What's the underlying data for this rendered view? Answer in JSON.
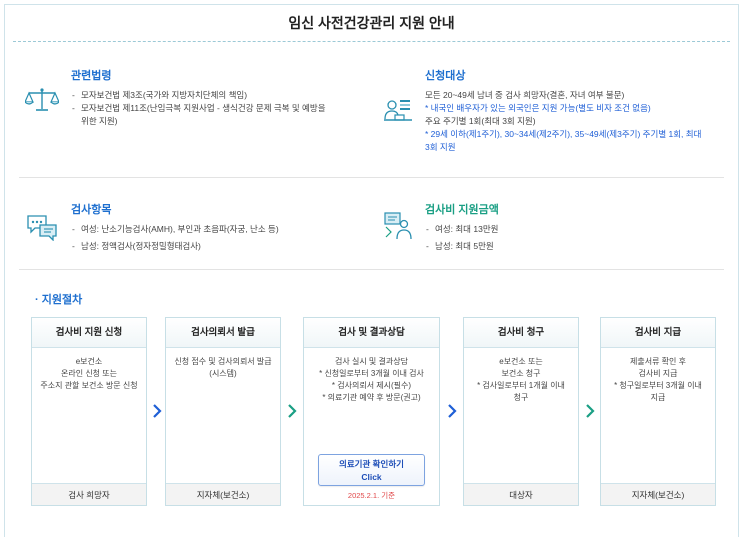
{
  "page_title": "임신 사전건강관리 지원 안내",
  "sections": {
    "laws": {
      "heading": "관련법령",
      "icon": "scales-icon",
      "items": [
        "모자보건법 제3조(국가와 지방자치단체의 책임)",
        "모자보건법 제11조(난임극복 지원사업 - 생식건강 문제 극복 및 예방을",
        "위한 지원)"
      ]
    },
    "target": {
      "heading": "신청대상",
      "icon": "person-desk-icon",
      "line1": "모든 20~49세 남녀 중 검사 희망자(결혼, 자녀 여부 불문)",
      "line2": "* 내국인 배우자가 있는 외국인은 지원 가능(별도 비자 조건 없음)",
      "line3": "주요 주기별 1회(최대 3회 지원)",
      "line4": "* 29세 이하(제1주기), 30~34세(제2주기), 35~49세(제3주기) 주기별 1회, 최대",
      "line5": "3회 지원"
    },
    "items": {
      "heading": "검사항목",
      "icon": "chat-bubbles-icon",
      "items": [
        "여성: 난소기능검사(AMH), 부인과 초음파(자궁, 난소 등)",
        "남성: 정액검사(정자정밀형태검사)"
      ]
    },
    "amount": {
      "heading": "검사비 지원금액",
      "icon": "consult-icon",
      "items": [
        "여성: 최대 13만원",
        "남성: 최대 5만원"
      ]
    }
  },
  "procedure": {
    "title": "· 지원절차",
    "steps": [
      {
        "head": "검사비 지원 신청",
        "lines": [
          "e보건소",
          "온라인 신청 또는",
          "주소지 관할 보건소 방문 신청"
        ],
        "foot": "검사 희망자"
      },
      {
        "head": "검사의뢰서 발급",
        "lines": [
          "신청 접수 및 검사의뢰서 발급",
          "(시스템)"
        ],
        "foot": "지자체(보건소)"
      },
      {
        "head": "검사 및 결과상담",
        "lines": [
          "검사 실시 및 결과상담",
          "* 신청일로부터 3개월 이내 검사",
          "* 검사의뢰서 제시(필수)",
          "* 의료기관 예약 후 방문(권고)"
        ],
        "button_line1": "의료기관 확인하기",
        "button_line2": "Click",
        "date_note": "2025.2.1. 기준"
      },
      {
        "head": "검사비 청구",
        "lines": [
          "e보건소 또는",
          "보건소 청구",
          "* 검사일로부터 1개월 이내",
          "청구"
        ],
        "foot": "대상자"
      },
      {
        "head": "검사비 지급",
        "lines": [
          "제출서류 확인 후",
          "검사비 지급",
          "* 청구일로부터 3개월 이내",
          "지급"
        ],
        "foot": "지자체(보건소)"
      }
    ],
    "arrow_colors": [
      "#1f5fd6",
      "#1a9f84",
      "#1f5fd6",
      "#1a9f84"
    ]
  },
  "colors": {
    "blue": "#1e6fcf",
    "teal": "#1a9f84",
    "red": "#e0484a"
  }
}
